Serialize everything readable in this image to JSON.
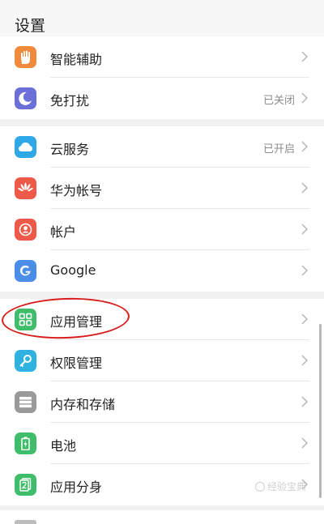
{
  "header": {
    "title": "设置"
  },
  "groups": [
    {
      "items": [
        {
          "label": "智能辅助",
          "status": "",
          "icon": "hand-icon",
          "color": "#f08a3c"
        },
        {
          "label": "免打扰",
          "status": "已关闭",
          "icon": "moon-icon",
          "color": "#6b6fd8"
        }
      ]
    },
    {
      "items": [
        {
          "label": "云服务",
          "status": "已开启",
          "icon": "cloud-icon",
          "color": "#2ea8e6"
        },
        {
          "label": "华为帐号",
          "status": "",
          "icon": "huawei-icon",
          "color": "#ee5a4a"
        },
        {
          "label": "帐户",
          "status": "",
          "icon": "account-icon",
          "color": "#ee5a4a"
        },
        {
          "label": "Google",
          "status": "",
          "icon": "google-icon",
          "color": "#4a8ee8"
        }
      ]
    },
    {
      "items": [
        {
          "label": "应用管理",
          "status": "",
          "icon": "apps-grid-icon",
          "color": "#3fbd6a"
        },
        {
          "label": "权限管理",
          "status": "",
          "icon": "key-icon",
          "color": "#2fb2e0"
        },
        {
          "label": "内存和存储",
          "status": "",
          "icon": "storage-icon",
          "color": "#9a9a9a"
        },
        {
          "label": "电池",
          "status": "",
          "icon": "battery-icon",
          "color": "#3fbd6a"
        },
        {
          "label": "应用分身",
          "status": "",
          "icon": "app-twin-icon",
          "color": "#3fbd6a"
        }
      ]
    }
  ],
  "watermark": "经验宝典",
  "colors": {
    "accent_circle": "#d81e1e",
    "background": "#f1f1f1"
  }
}
